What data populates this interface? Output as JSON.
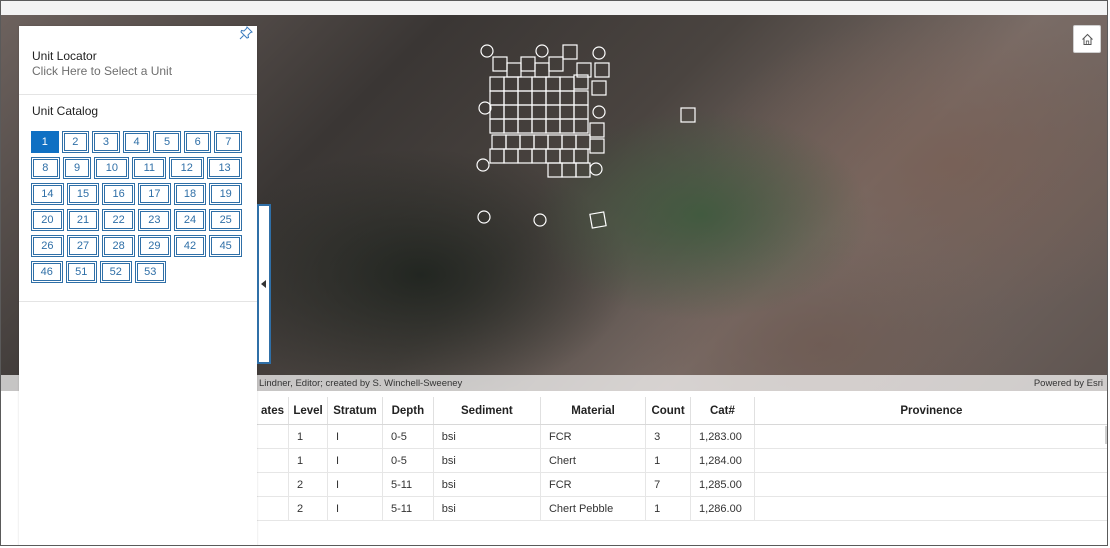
{
  "panel": {
    "locator_title": "Unit Locator",
    "locator_hint": "Click Here to Select a Unit",
    "catalog_title": "Unit Catalog",
    "units": [
      [
        "1",
        "2",
        "3",
        "4",
        "5",
        "6",
        "7"
      ],
      [
        "8",
        "9",
        "10",
        "11",
        "12",
        "13"
      ],
      [
        "14",
        "15",
        "16",
        "17",
        "18",
        "19"
      ],
      [
        "20",
        "21",
        "22",
        "23",
        "24",
        "25"
      ],
      [
        "26",
        "27",
        "28",
        "29",
        "42",
        "45"
      ],
      [
        "46",
        "51",
        "52",
        "53"
      ]
    ],
    "selected_unit": "1"
  },
  "map": {
    "attribution_left": "Lindner, Editor; created by S. Winchell-Sweeney",
    "attribution_right": "Powered by Esri"
  },
  "table": {
    "columns": [
      "ates",
      "Level",
      "Stratum",
      "Depth",
      "Sediment",
      "Material",
      "Count",
      "Cat#",
      "Provinence"
    ],
    "rows": [
      [
        "",
        "1",
        "I",
        "0-5",
        "bsi",
        "FCR",
        "3",
        "1,283.00",
        ""
      ],
      [
        "",
        "1",
        "I",
        "0-5",
        "bsi",
        "Chert",
        "1",
        "1,284.00",
        ""
      ],
      [
        "",
        "2",
        "I",
        "5-11",
        "bsi",
        "FCR",
        "7",
        "1,285.00",
        ""
      ],
      [
        "",
        "2",
        "I",
        "5-11",
        "bsi",
        "Chert Pebble",
        "1",
        "1,286.00",
        ""
      ]
    ]
  },
  "icons": {
    "pin": "pin-icon",
    "home": "home-icon",
    "collapse": "chevron-left-icon"
  }
}
